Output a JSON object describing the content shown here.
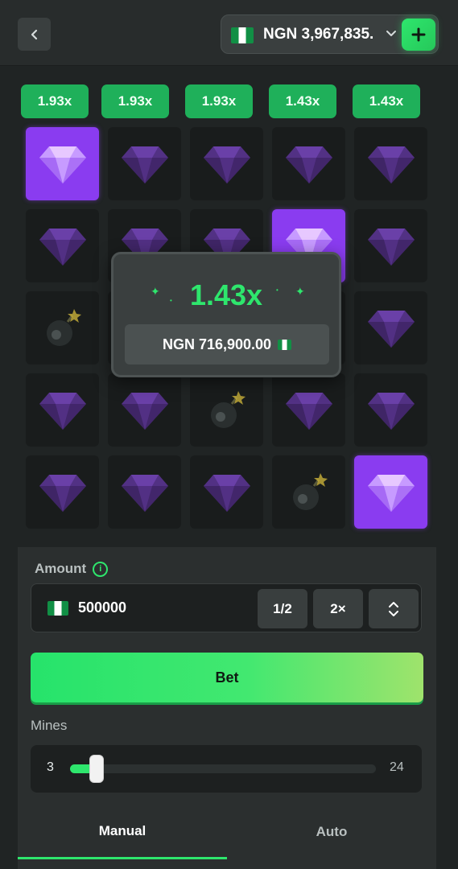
{
  "header": {
    "back_icon": "chevron-left-icon",
    "balance": "NGN 3,967,835.",
    "balance_dropdown_icon": "chevron-down-icon",
    "add_icon": "plus-icon"
  },
  "board": {
    "multipliers": [
      "1.93x",
      "1.93x",
      "1.93x",
      "1.43x",
      "1.43x"
    ],
    "grid": [
      [
        "gem-revealed",
        "gem",
        "gem",
        "gem",
        "gem"
      ],
      [
        "gem",
        "gem",
        "gem",
        "gem-revealed",
        "gem"
      ],
      [
        "mine",
        "gem",
        "gem",
        "gem",
        "gem"
      ],
      [
        "gem",
        "gem",
        "mine",
        "gem",
        "gem"
      ],
      [
        "gem",
        "gem",
        "gem",
        "mine",
        "gem-revealed"
      ]
    ]
  },
  "win_popup": {
    "multiplier": "1.43x",
    "amount": "NGN 716,900.00"
  },
  "controls": {
    "amount_label": "Amount",
    "amount_value": "500000",
    "half_label": "1/2",
    "double_label": "2×",
    "bet_label": "Bet",
    "mines_label": "Mines",
    "mines_min": "3",
    "mines_max": "24",
    "mines_slider_fraction": 0.0
  },
  "tabs": {
    "manual": "Manual",
    "auto": "Auto"
  },
  "colors": {
    "accent_green": "#2ee66d",
    "revealed_purple": "#8a3cf0",
    "multiplier_green": "#1fb05a"
  }
}
